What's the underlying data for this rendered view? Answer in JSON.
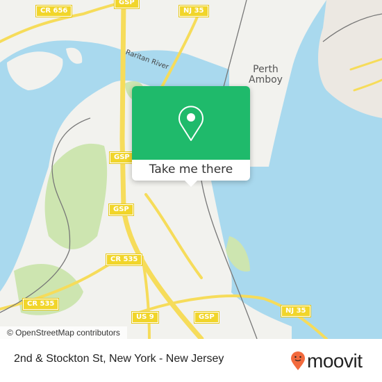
{
  "map": {
    "colors": {
      "water": "#a9d9ee",
      "land": "#f2f2ee",
      "park": "#cde5b0",
      "road": "#f6dc5a",
      "rail": "#777777",
      "urban": "#ece8e2"
    },
    "shields": [
      {
        "label": "CR 656"
      },
      {
        "label": "GSP"
      },
      {
        "label": "NJ 35"
      },
      {
        "label": "GSP"
      },
      {
        "label": "GSP"
      },
      {
        "label": "CR 535"
      },
      {
        "label": "CR 535"
      },
      {
        "label": "US 9"
      },
      {
        "label": "GSP"
      },
      {
        "label": "NJ 35"
      }
    ],
    "places": [
      {
        "label": "Perth\nAmboy"
      }
    ],
    "water_labels": [
      {
        "label": "Raritan River"
      }
    ],
    "attribution": "© OpenStreetMap contributors"
  },
  "popup": {
    "icon": "map-pin-icon",
    "button_label": "Take me there",
    "accent": "#1fba6b"
  },
  "footer": {
    "location_title": "2nd & Stockton St, New York - New Jersey",
    "brand": "moovit",
    "brand_color": "#f26a3d"
  }
}
